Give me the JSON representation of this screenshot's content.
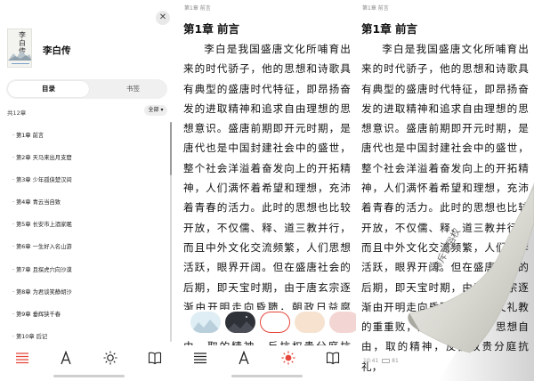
{
  "toc": {
    "close_glyph": "✕",
    "cover_title_chars": "李白传",
    "book_title": "李白传",
    "tabs": {
      "contents": "目录",
      "bookmarks": "书签"
    },
    "count": "共12章",
    "filter": "全部",
    "chapters": [
      "· 第1章 前言",
      "· 第2章 天马来出月支窟",
      "· 第3章 少年孤侠楚汉间",
      "· 第4章 青云当自致",
      "· 第5章 长安市上酒家眠",
      "· 第6章 一生好入名山游",
      "· 第7章 且探虎穴向沙漠",
      "· 第8章 为君谈笑静胡沙",
      "· 第9章 垂辉狭千春",
      "· 第10章 后记"
    ]
  },
  "reader": {
    "running_head": "第1章 前言",
    "chapter_title": "第1章 前言",
    "paragraph": "李白是我国盛唐文化所哺育出来的时代骄子，他的思想和诗歌具有典型的盛唐时代特征，即昂扬奋发的进取精神和追求自由理想的思想意识。盛唐前期即开元时期，是唐代也是中国封建社会中的盛世，整个社会洋溢着奋发向上的开拓精神，人们满怀着希望和理想，充沛着青春的活力。此时的思想也比较开放，不仅儒、释、道三教并行，而且中外文化交流频繁，人们思想活跃，眼界开阔。但在盛唐社会的后期，即天宝时期，由于唐玄宗逐渐由开明走向昏聩，朝政日益腐败，国势由盛转衰，个人的思想自由，取的精神，反抗权贵分庭抗礼，"
  },
  "themes": [
    {
      "name": "theme-mountain",
      "color": "#dfeef4"
    },
    {
      "name": "theme-night",
      "color": "#2f3138"
    },
    {
      "name": "theme-white",
      "color": "#ffffff",
      "selected": true
    },
    {
      "name": "theme-peach",
      "color": "#f6e2cf"
    },
    {
      "name": "theme-pink",
      "color": "#f3d6d3"
    }
  ],
  "curl_page": {
    "running_head": "第1章 前言",
    "chapter_title": "第1章 前言",
    "paragraph": "李白是我国盛唐文化所哺育出来的时代骄子，他的思想和诗歌具有典型的盛唐时代特征，即昂扬奋发的进取精神和追求自由理想的思想意识。盛唐前期即开元时期，是唐代也是中国封建社会中的盛世，整个社会洋溢着奋发向上的开拓精神，人们满怀着希望和理想，充沛着青春的活力。此时的思想也比较开放，不仅儒、释、道三教并行，而且中外文化交流频繁，人们使李活跃，眼界开阔。但在盛唐社会的后期，即天宝时期，由于唐玄宗逐渐由开明走向昏聩，的精神又礼教的重重败，国势由盛转衰，思想自由，取的精神，反抗权贵分庭抗礼，",
    "back_text": "排斥世俗权",
    "status_time": "10:41",
    "status_battery": "81"
  },
  "accent": "#e5453a"
}
